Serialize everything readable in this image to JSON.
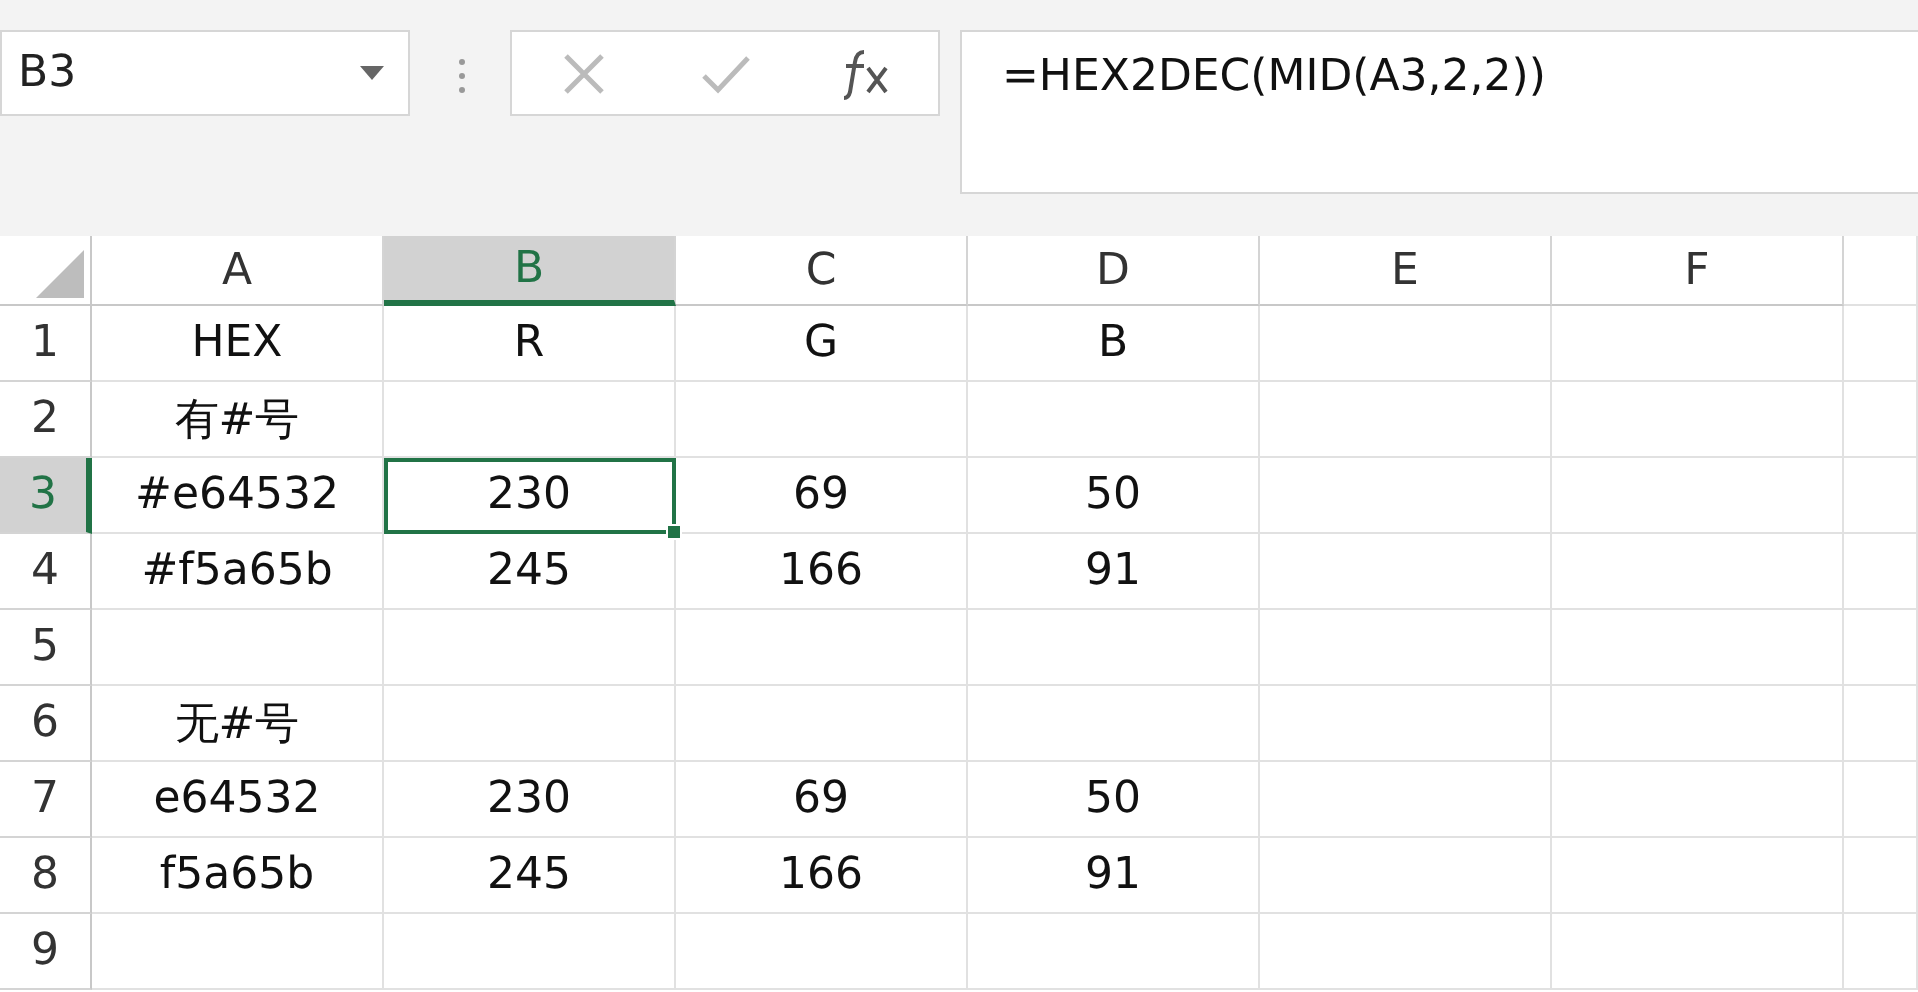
{
  "name_box": {
    "value": "B3"
  },
  "formula_bar": {
    "formula": "=HEX2DEC(MID(A3,2,2))"
  },
  "columns": [
    {
      "label": "A",
      "selected": false
    },
    {
      "label": "B",
      "selected": true
    },
    {
      "label": "C",
      "selected": false
    },
    {
      "label": "D",
      "selected": false
    },
    {
      "label": "E",
      "selected": false
    },
    {
      "label": "F",
      "selected": false
    }
  ],
  "rows": [
    {
      "label": "1",
      "selected": false,
      "cells": [
        {
          "text": "HEX",
          "selected": false
        },
        {
          "text": "R",
          "selected": false
        },
        {
          "text": "G",
          "selected": false
        },
        {
          "text": "B",
          "selected": false
        }
      ]
    },
    {
      "label": "2",
      "selected": false,
      "cells": [
        {
          "text": "有#号",
          "selected": false
        }
      ]
    },
    {
      "label": "3",
      "selected": true,
      "cells": [
        {
          "text": "#e64532",
          "selected": false
        },
        {
          "text": "230",
          "selected": true
        },
        {
          "text": "69",
          "selected": false
        },
        {
          "text": "50",
          "selected": false
        }
      ]
    },
    {
      "label": "4",
      "selected": false,
      "cells": [
        {
          "text": "#f5a65b",
          "selected": false
        },
        {
          "text": "245",
          "selected": false
        },
        {
          "text": "166",
          "selected": false
        },
        {
          "text": "91",
          "selected": false
        }
      ]
    },
    {
      "label": "5",
      "selected": false,
      "cells": []
    },
    {
      "label": "6",
      "selected": false,
      "cells": [
        {
          "text": "无#号",
          "selected": false
        }
      ]
    },
    {
      "label": "7",
      "selected": false,
      "cells": [
        {
          "text": "e64532",
          "selected": false
        },
        {
          "text": "230",
          "selected": false
        },
        {
          "text": "69",
          "selected": false
        },
        {
          "text": "50",
          "selected": false
        }
      ]
    },
    {
      "label": "8",
      "selected": false,
      "cells": [
        {
          "text": "f5a65b",
          "selected": false
        },
        {
          "text": "245",
          "selected": false
        },
        {
          "text": "166",
          "selected": false
        },
        {
          "text": "91",
          "selected": false
        }
      ]
    },
    {
      "label": "9",
      "selected": false,
      "cells": []
    }
  ]
}
